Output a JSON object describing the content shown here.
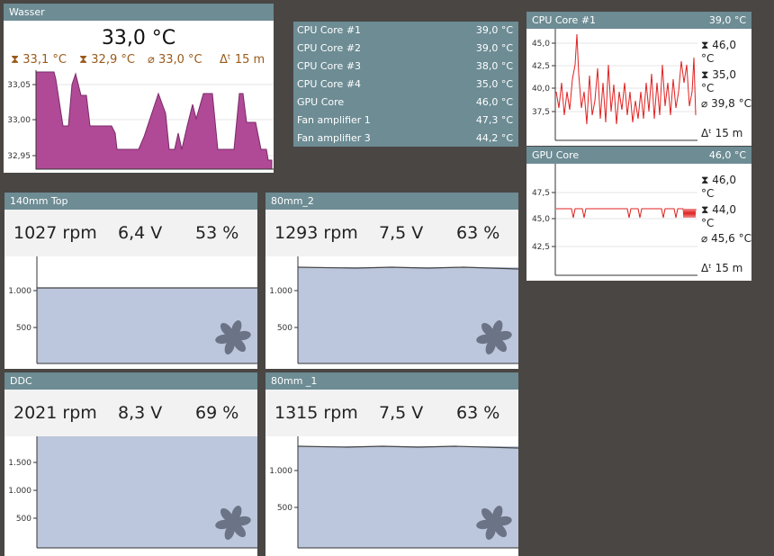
{
  "wasser": {
    "title": "Wasser",
    "current": "33,0 °C",
    "max": "33,1 °C",
    "min": "32,9 °C",
    "avg": "33,0 °C",
    "span": "15 m",
    "y_ticks": [
      "33,05",
      "33,00",
      "32,95"
    ],
    "fill_color": "#b04a96"
  },
  "sensor_list": [
    {
      "name": "CPU Core #1",
      "value": "39,0 °C"
    },
    {
      "name": "CPU Core #2",
      "value": "39,0 °C"
    },
    {
      "name": "CPU Core #3",
      "value": "38,0 °C"
    },
    {
      "name": "CPU Core #4",
      "value": "35,0 °C"
    },
    {
      "name": "GPU Core",
      "value": "46,0 °C"
    },
    {
      "name": "Fan amplifier 1",
      "value": "47,3 °C"
    },
    {
      "name": "Fan amplifier 3",
      "value": "44,2 °C"
    }
  ],
  "cpu_core1": {
    "title": "CPU Core #1",
    "value": "39,0 °C",
    "max": "46,0 °C",
    "min": "35,0 °C",
    "avg": "39,8 °C",
    "span": "15 m",
    "y_ticks": [
      "45,0",
      "42,5",
      "40,0",
      "37,5"
    ],
    "line_color": "#e02020"
  },
  "gpu_core": {
    "title": "GPU Core",
    "value": "46,0 °C",
    "max": "46,0 °C",
    "min": "44,0 °C",
    "avg": "45,6 °C",
    "span": "15 m",
    "y_ticks": [
      "47,5",
      "45,0",
      "42,5"
    ],
    "line_color": "#e02020"
  },
  "fans": {
    "fan_140_top": {
      "title": "140mm Top",
      "rpm": "1027 rpm",
      "volt": "6,4 V",
      "pct": "53 %",
      "y_ticks": [
        "1.000",
        "500"
      ]
    },
    "fan_80_2": {
      "title": "80mm_2",
      "rpm": "1293 rpm",
      "volt": "7,5 V",
      "pct": "63 %",
      "y_ticks": [
        "1.000",
        "500"
      ]
    },
    "fan_ddc": {
      "title": "DDC",
      "rpm": "2021 rpm",
      "volt": "8,3 V",
      "pct": "69 %",
      "y_ticks": [
        "1.500",
        "1.000",
        "500"
      ]
    },
    "fan_80_1": {
      "title": "80mm _1",
      "rpm": "1315 rpm",
      "volt": "7,5 V",
      "pct": "63 %",
      "y_ticks": [
        "1.000",
        "500"
      ]
    }
  },
  "colors": {
    "header": "#6d8c94",
    "fan_fill": "#bcc6dc",
    "background": "#4a4644"
  }
}
